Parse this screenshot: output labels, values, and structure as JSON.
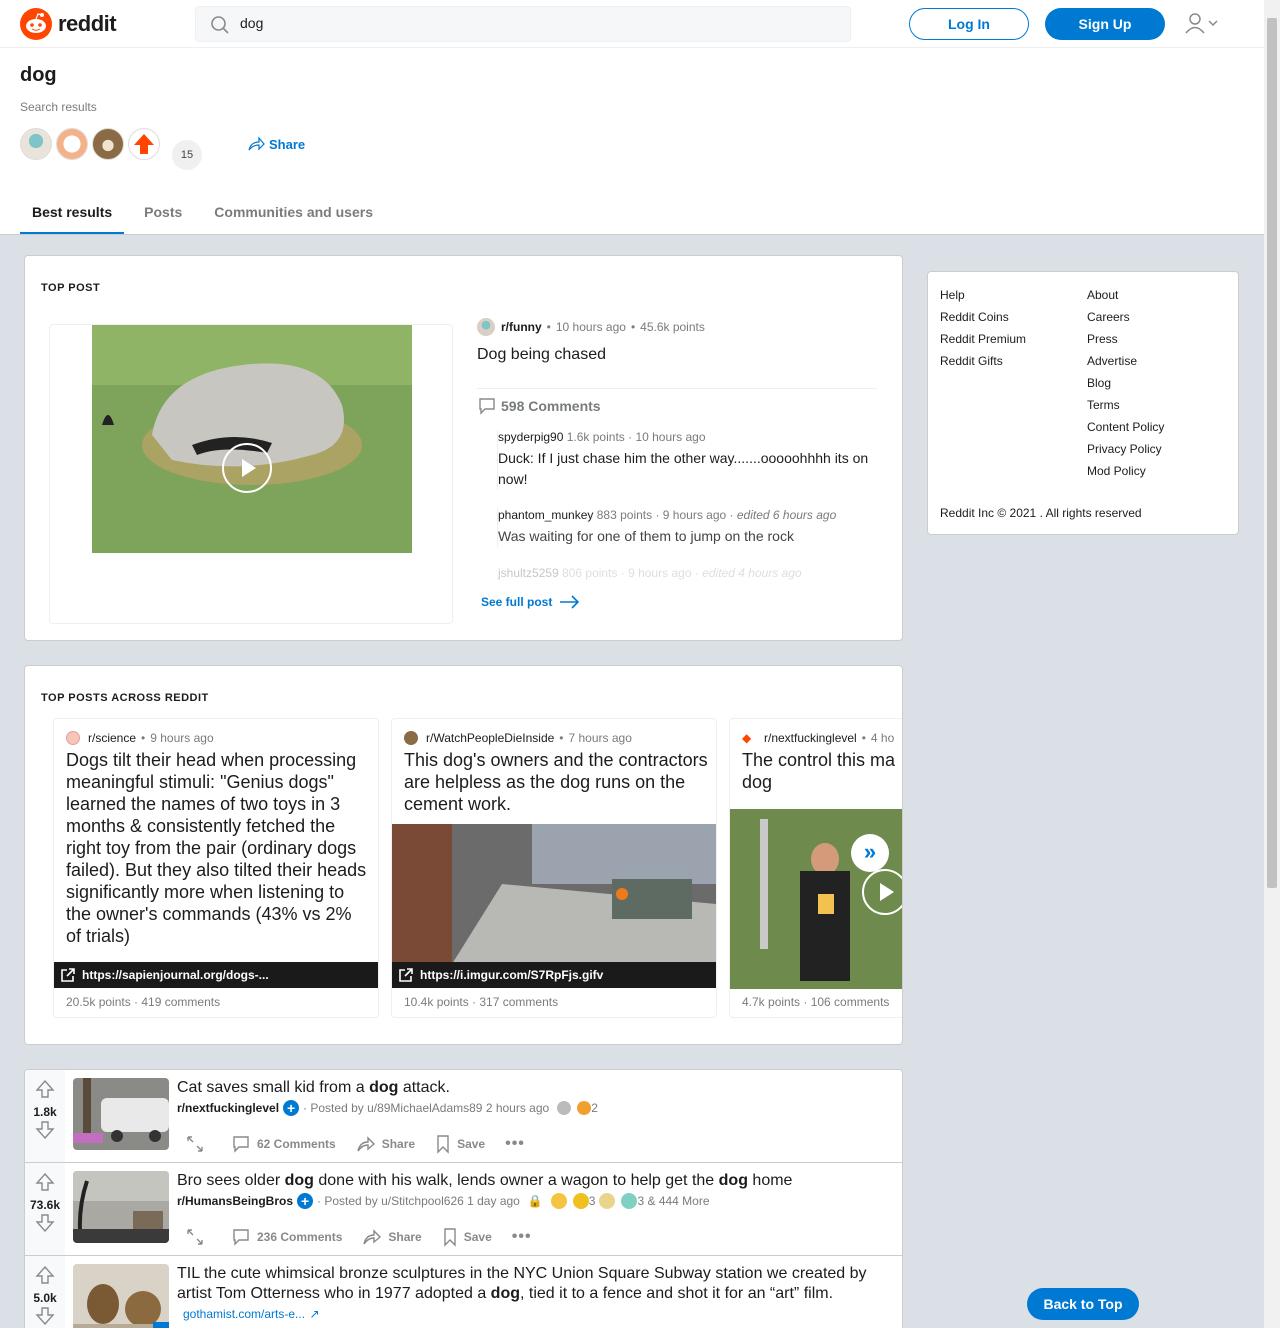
{
  "header": {
    "logo_text": "reddit",
    "search_value": "dog",
    "login_label": "Log In",
    "signup_label": "Sign Up"
  },
  "search_head": {
    "title": "dog",
    "subtitle": "Search results",
    "avatar_count": "15",
    "share_label": "Share",
    "tabs": [
      "Best results",
      "Posts",
      "Communities and users"
    ]
  },
  "top_post": {
    "section_label": "TOP POST",
    "subreddit": "r/funny",
    "time": "10 hours ago",
    "points": "45.6k points",
    "title": "Dog being chased",
    "comments_label": "598 Comments",
    "comments": [
      {
        "user": "spyderpig90",
        "points": "1.6k points",
        "time": "10 hours ago",
        "edited": "",
        "body": "Duck: If I just chase him the other way.......ooooohhhh its on now!"
      },
      {
        "user": "phantom_munkey",
        "points": "883 points",
        "time": "9 hours ago",
        "edited": "edited 6 hours ago",
        "body": "Was waiting for one of them to jump on the rock"
      },
      {
        "user": "jshultz5259",
        "points": "806 points",
        "time": "9 hours ago",
        "edited": "edited 4 hours ago",
        "body": ""
      }
    ],
    "see_full_label": "See full post"
  },
  "top_across": {
    "section_label": "TOP POSTS ACROSS REDDIT",
    "cards": [
      {
        "subreddit": "r/science",
        "time": "9 hours ago",
        "title": "Dogs tilt their head when processing meaningful stimuli: \"Genius dogs\" learned the names of two toys in 3 months & consistently fetched the right toy from the pair (ordinary dogs failed). But they also tilted their heads significantly more when listening to the owner's commands (43% vs 2% of trials)",
        "link": "https://sapienjournal.org/dogs-...",
        "stats": "20.5k points · 419 comments"
      },
      {
        "subreddit": "r/WatchPeopleDieInside",
        "time": "7 hours ago",
        "title": "This dog's owners and the contractors are helpless as the dog runs on the cement work.",
        "link": "https://i.imgur.com/S7RpFjs.gifv",
        "stats": "10.4k points · 317 comments"
      },
      {
        "subreddit": "r/nextfuckinglevel",
        "time": "4 ho",
        "title": "The control this ma dog",
        "link": "",
        "stats": "4.7k points · 106 comments"
      }
    ]
  },
  "posts": [
    {
      "score": "1.8k",
      "title_parts": [
        "Cat saves small kid from a ",
        "dog",
        " attack."
      ],
      "subreddit": "r/nextfuckinglevel",
      "posted_by": "· Posted by u/89MichaelAdams89 2 hours ago",
      "awards": "2",
      "comments": "62 Comments",
      "share": "Share",
      "save": "Save"
    },
    {
      "score": "73.6k",
      "title_parts": [
        "Bro sees older ",
        "dog",
        " done with his walk, lends owner a wagon to help get the ",
        "dog",
        " home"
      ],
      "subreddit": "r/HumansBeingBros",
      "posted_by": "· Posted by u/Stitchpool626 1 day ago",
      "awards": "3 & 444 More",
      "award_a": "3",
      "comments": "236 Comments",
      "share": "Share",
      "save": "Save"
    },
    {
      "score": "5.0k",
      "title_parts": [
        "TIL the cute whimsical bronze sculptures in the NYC Union Square Subway station we created by artist Tom Otterness who in 1977 adopted a ",
        "dog",
        ", tied it to a fence and shot it for an “art” film."
      ],
      "link": "gothamist.com/arts-e..."
    }
  ],
  "footer": {
    "col1": [
      "Help",
      "Reddit Coins",
      "Reddit Premium",
      "Reddit Gifts"
    ],
    "col2": [
      "About",
      "Careers",
      "Press",
      "Advertise",
      "Blog",
      "Terms",
      "Content Policy",
      "Privacy Policy",
      "Mod Policy"
    ],
    "copyright": "Reddit Inc © 2021 . All rights reserved"
  },
  "back_to_top": "Back to Top",
  "colors": {
    "brand": "#ff4500",
    "accent": "#0079d3",
    "background": "#dae0e6"
  }
}
